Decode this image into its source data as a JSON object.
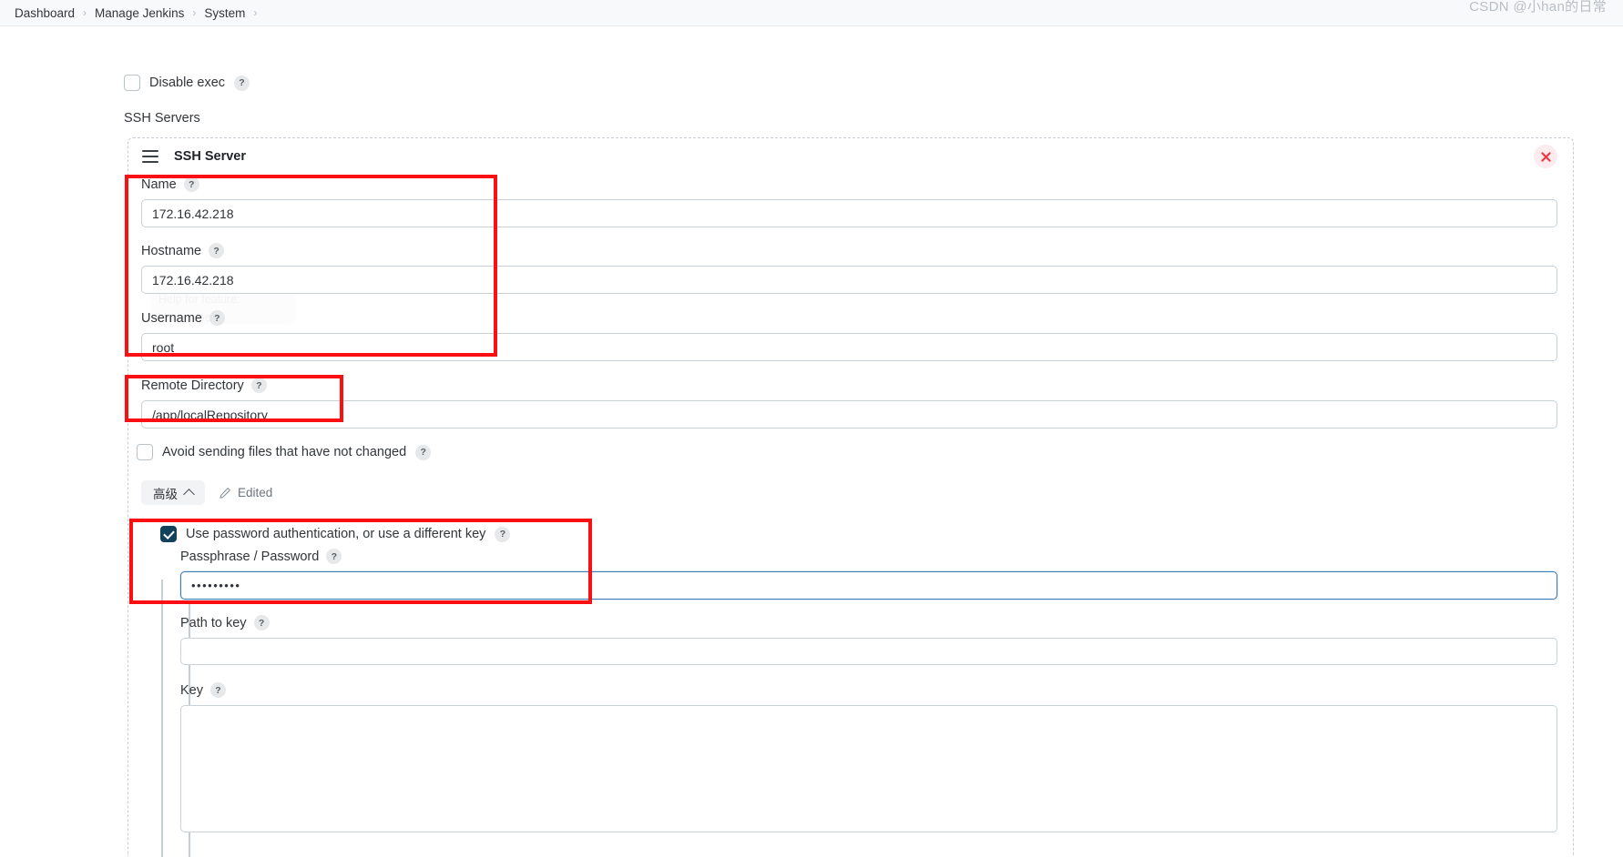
{
  "breadcrumb": {
    "items": [
      {
        "label": "Dashboard"
      },
      {
        "label": "Manage Jenkins"
      },
      {
        "label": "System"
      }
    ],
    "separator": "›"
  },
  "form": {
    "disable_exec": {
      "label": "Disable exec",
      "checked": false,
      "help": "?"
    },
    "ssh_servers_label": "SSH Servers",
    "panel": {
      "title": "SSH Server",
      "close_icon": "close-icon",
      "drag_icon": "drag-handle-icon"
    },
    "fields": {
      "name": {
        "label": "Name",
        "value": "172.16.42.218",
        "help": "?",
        "placeholder": ""
      },
      "hostname": {
        "label": "Hostname",
        "value": "172.16.42.218",
        "help": "?",
        "placeholder": ""
      },
      "username": {
        "label": "Username",
        "value": "root",
        "help": "?",
        "placeholder": ""
      },
      "remote_directory": {
        "label": "Remote Directory",
        "value": "/app/localRepository",
        "help": "?",
        "placeholder": ""
      },
      "passphrase": {
        "label": "Passphrase / Password",
        "value": "•••••••••",
        "help": "?",
        "placeholder": ""
      },
      "path_to_key": {
        "label": "Path to key",
        "value": "",
        "help": "?",
        "placeholder": ""
      },
      "key": {
        "label": "Key",
        "value": "",
        "help": "?",
        "placeholder": ""
      }
    },
    "avoid_sending": {
      "label": "Avoid sending files that have not changed",
      "checked": false,
      "help": "?"
    },
    "advanced": {
      "button_label": "高级",
      "chevron": "chevron-up-icon",
      "edited_label": "Edited",
      "edited_icon": "pencil-icon"
    },
    "use_password_auth": {
      "label": "Use password authentication, or use a different key",
      "checked": true,
      "help": "?"
    },
    "ghost_tooltip": "Help for feature: Username"
  },
  "colors": {
    "annotation_red": "#fa0f12",
    "checkbox_checked": "#12415c",
    "focus_border": "#3f7db5",
    "close_icon": "#f5333f",
    "close_bg": "#fdecef"
  },
  "watermark": "CSDN @小han的日常"
}
